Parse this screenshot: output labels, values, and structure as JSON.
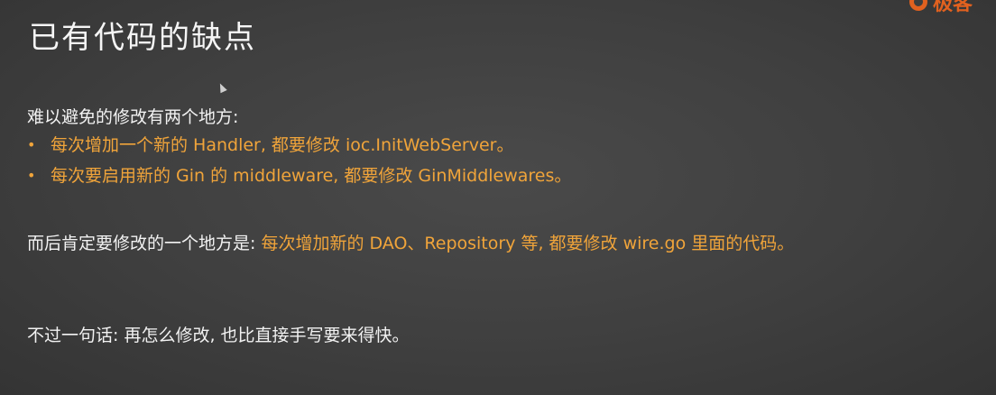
{
  "slide": {
    "title": "已有代码的缺点",
    "logo_text": "极客"
  },
  "intro": "难以避免的修改有两个地方:",
  "bullets": [
    "每次增加一个新的 Handler, 都要修改 ioc.InitWebServer。",
    "每次要启用新的 Gin 的 middleware, 都要修改 GinMiddlewares。"
  ],
  "second": {
    "prefix": "而后肯定要修改的一个地方是: ",
    "highlight": "每次增加新的 DAO、Repository 等, 都要修改 wire.go 里面的代码。"
  },
  "conclusion": "不过一句话: 再怎么修改, 也比直接手写要来得快。",
  "colors": {
    "accent": "#f0a43a",
    "logo": "#e2611f",
    "background": "#3f3f3f",
    "text": "#f2f2f2"
  }
}
